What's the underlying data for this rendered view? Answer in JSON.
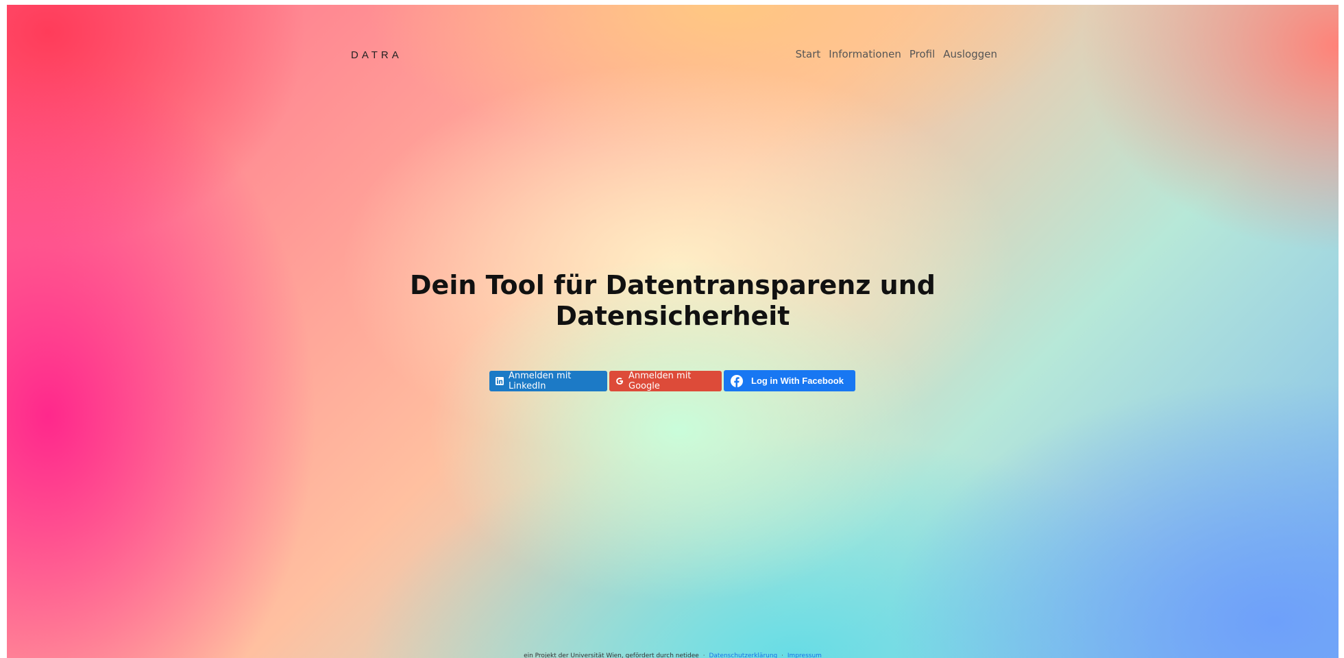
{
  "header": {
    "brand": "DATRA",
    "nav": {
      "start": "Start",
      "informationen": "Informationen",
      "profil": "Profil",
      "ausloggen": "Ausloggen"
    }
  },
  "hero": {
    "title_line1": "Dein Tool für Datentransparenz und",
    "title_line2": "Datensicherheit"
  },
  "login_buttons": {
    "linkedin": "Anmelden mit LinkedIn",
    "google": "Anmelden mit Google",
    "facebook": "Log in With Facebook"
  },
  "footer": {
    "text": "ein Projekt der Universität Wien, gefördert durch netidee",
    "separator": "·",
    "privacy_link": "Datenschutzerklärung",
    "imprint_link": "Impressum"
  },
  "colors": {
    "linkedin": "#1c7ac6",
    "google": "#dd4b39",
    "facebook": "#1877f2",
    "link": "#1a73e8"
  },
  "icons": [
    "linkedin-icon",
    "google-icon",
    "facebook-icon"
  ]
}
